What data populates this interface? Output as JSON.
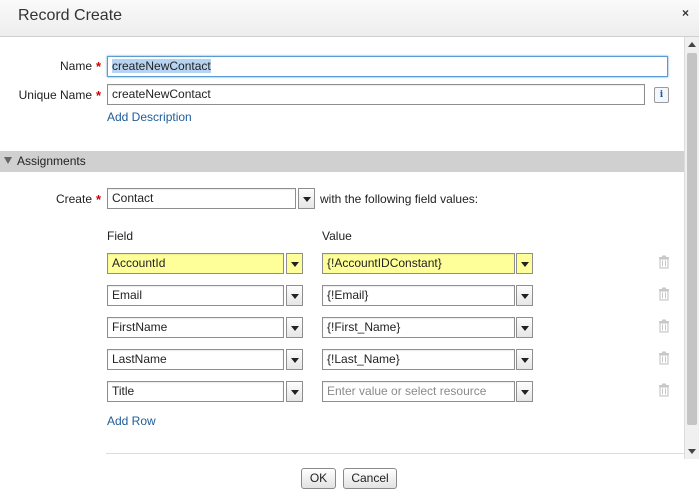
{
  "dialog": {
    "title": "Record Create",
    "close_glyph": "×"
  },
  "fields": {
    "name_label": "Name",
    "name_value": "createNewContact",
    "unique_name_label": "Unique Name",
    "unique_name_value": "createNewContact",
    "add_description": "Add Description",
    "required_glyph": "*",
    "info_glyph": "i"
  },
  "assignments": {
    "section_title": "Assignments",
    "create_label": "Create",
    "create_object": "Contact",
    "with_values_text": "with the following field values:",
    "field_header": "Field",
    "value_header": "Value",
    "rows": [
      {
        "field": "AccountId",
        "value": "{!AccountIDConstant}",
        "highlighted": true
      },
      {
        "field": "Email",
        "value": "{!Email}",
        "highlighted": false
      },
      {
        "field": "FirstName",
        "value": "{!First_Name}",
        "highlighted": false
      },
      {
        "field": "LastName",
        "value": "{!Last_Name}",
        "highlighted": false
      },
      {
        "field": "Title",
        "value": "",
        "placeholder": "Enter value or select resource",
        "highlighted": false
      }
    ],
    "add_row": "Add Row"
  },
  "footer": {
    "ok_label": "OK",
    "cancel_label": "Cancel"
  },
  "colors": {
    "required": "#cc0000",
    "link": "#1f5c99",
    "highlight": "#ffff99",
    "section_bar": "#d0d0d0"
  },
  "icons": [
    "close-icon",
    "info-icon",
    "collapse-triangle-icon",
    "dropdown-arrow-icon",
    "trash-icon",
    "scroll-up-icon",
    "scroll-down-icon"
  ]
}
